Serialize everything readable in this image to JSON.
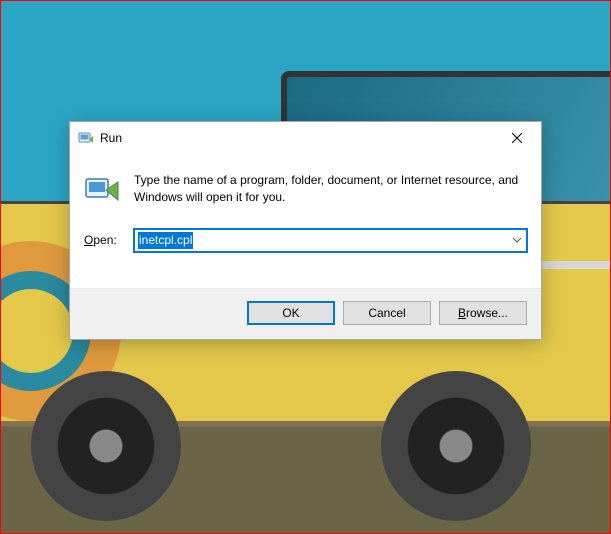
{
  "dialog": {
    "title": "Run",
    "description": "Type the name of a program, folder, document, or Internet resource, and Windows will open it for you.",
    "open_label": "Open:",
    "input_value": "inetcpl.cpl",
    "buttons": {
      "ok": "OK",
      "cancel": "Cancel",
      "browse": "Browse..."
    }
  },
  "icons": {
    "run_small": "run-icon",
    "run_large": "run-icon",
    "close": "close-icon",
    "dropdown": "chevron-down-icon"
  }
}
